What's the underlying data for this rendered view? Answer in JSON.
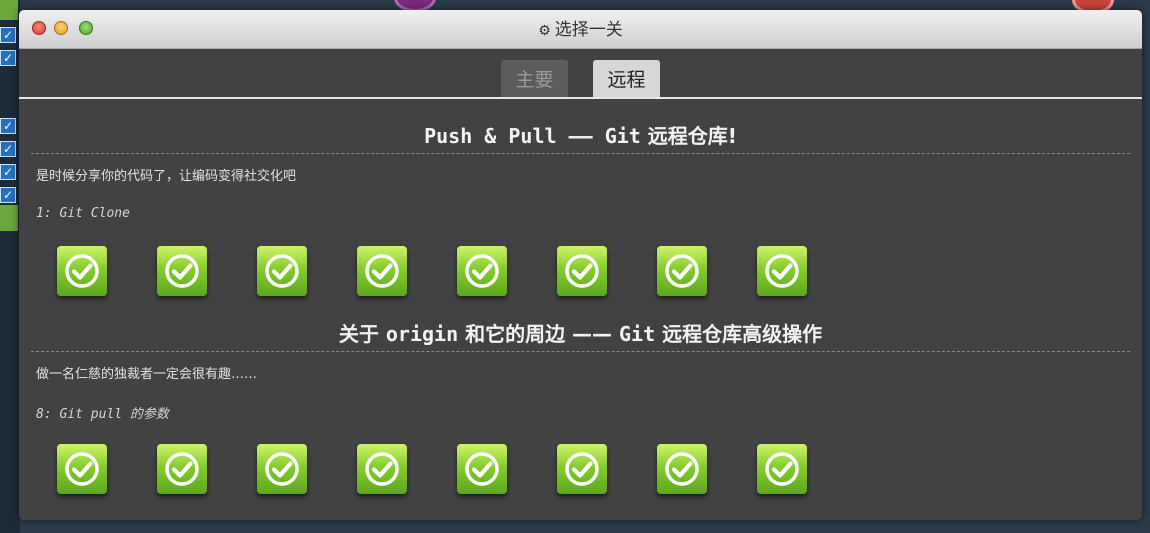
{
  "window": {
    "title": "选择一关",
    "title_icon": "gear-icon"
  },
  "tabs": [
    {
      "label": "主要",
      "active": false
    },
    {
      "label": "远程",
      "active": true
    }
  ],
  "sections": [
    {
      "title": "Push & Pull —— Git 远程仓库!",
      "title_mono_part": "Push & Pull —— Git",
      "title_rest": " 远程仓库!",
      "description": "是时候分享你的代码了，让编码变得社交化吧",
      "subtitle": "1: Git Clone",
      "levels": [
        {
          "status": "completed",
          "icon": "check-circle-icon"
        },
        {
          "status": "completed",
          "icon": "check-circle-icon"
        },
        {
          "status": "completed",
          "icon": "check-circle-icon"
        },
        {
          "status": "completed",
          "icon": "check-circle-icon"
        },
        {
          "status": "completed",
          "icon": "check-circle-icon"
        },
        {
          "status": "completed",
          "icon": "check-circle-icon"
        },
        {
          "status": "completed",
          "icon": "check-circle-icon"
        },
        {
          "status": "completed",
          "icon": "check-circle-icon"
        }
      ]
    },
    {
      "title": "关于 origin 和它的周边 —— Git 远程仓库高级操作",
      "title_pre": "关于 ",
      "title_mono": "origin",
      "title_mid": " 和它的周边 —— ",
      "title_mono2": "Git",
      "title_post": " 远程仓库高级操作",
      "description": "做一名仁慈的独裁者一定会很有趣……",
      "subtitle": "8: Git pull 的参数",
      "levels": [
        {
          "status": "completed",
          "icon": "check-circle-icon"
        },
        {
          "status": "completed",
          "icon": "check-circle-icon"
        },
        {
          "status": "completed",
          "icon": "check-circle-icon"
        },
        {
          "status": "completed",
          "icon": "check-circle-icon"
        },
        {
          "status": "completed",
          "icon": "check-circle-icon"
        },
        {
          "status": "completed",
          "icon": "check-circle-icon"
        },
        {
          "status": "completed",
          "icon": "check-circle-icon"
        },
        {
          "status": "completed",
          "icon": "check-circle-icon"
        }
      ]
    }
  ],
  "colors": {
    "window_bg": "#424242",
    "level_green": "#7cc22a",
    "tab_active_bg": "#d7d7d7",
    "tab_inactive_bg": "#5c5c5c"
  }
}
